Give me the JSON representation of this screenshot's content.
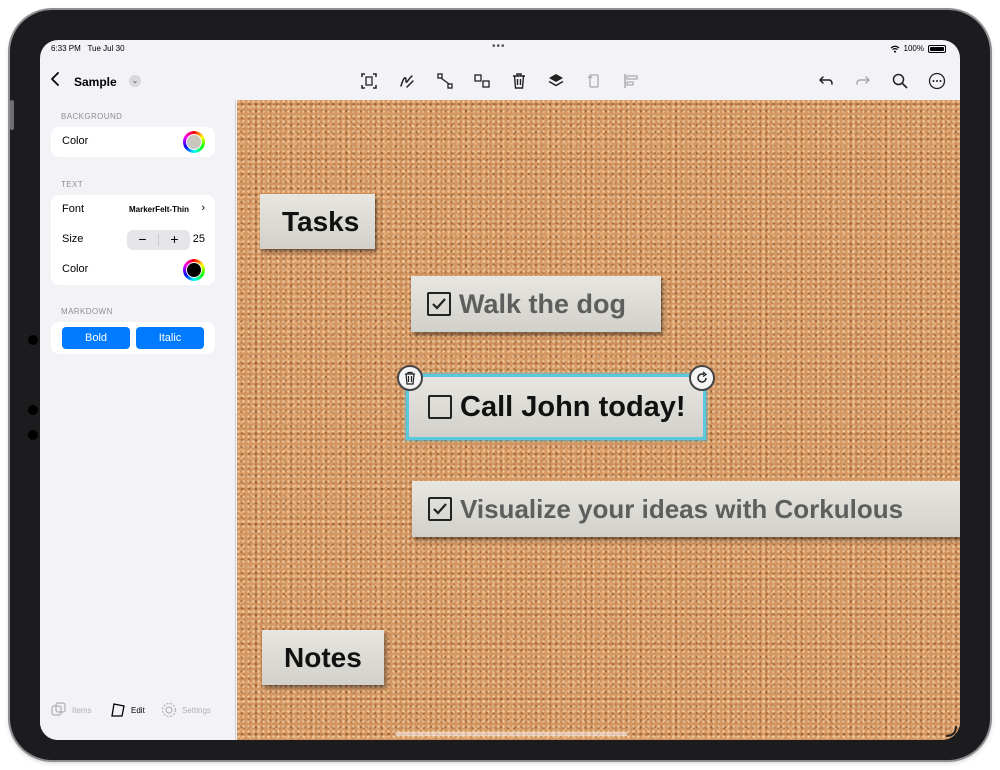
{
  "status": {
    "time": "6:33 PM",
    "date": "Tue Jul 30",
    "battery": "100%"
  },
  "toolbar": {
    "title": "Sample",
    "icons": [
      "back-icon",
      "text-box-icon",
      "draw-icon",
      "connect-icon",
      "group-icon",
      "trash-icon",
      "layers-icon",
      "rotate-icon",
      "align-icon",
      "undo-icon",
      "redo-icon",
      "search-icon",
      "more-icon"
    ]
  },
  "sidebar": {
    "background": {
      "header": "BACKGROUND",
      "color_label": "Color",
      "color": "#c7c7bd"
    },
    "text": {
      "header": "TEXT",
      "font_label": "Font",
      "font_value": "MarkerFelt-Thin",
      "size_label": "Size",
      "size_value": "25",
      "minus": "−",
      "plus": "+",
      "color_label": "Color",
      "color": "#000000"
    },
    "markdown": {
      "header": "MARKDOWN",
      "bold": "Bold",
      "italic": "Italic"
    },
    "tabs": {
      "items": "Items",
      "edit": "Edit",
      "settings": "Settings"
    }
  },
  "canvas": {
    "notes": [
      {
        "text": "Tasks",
        "checkbox": "none"
      },
      {
        "text": "Walk the dog",
        "checkbox": "checked"
      },
      {
        "text": "Call John today!",
        "checkbox": "unchecked",
        "selected": true
      },
      {
        "text": "Visualize your ideas with Corkulous",
        "checkbox": "checked"
      },
      {
        "text": "Notes",
        "checkbox": "none"
      }
    ]
  },
  "colors": {
    "accent": "#007aff",
    "selection": "#5bc8e0",
    "cork": "#d59762"
  }
}
